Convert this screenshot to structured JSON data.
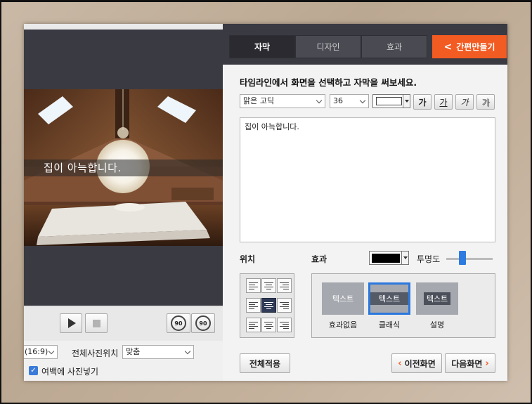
{
  "preview": {
    "subtitle": "집이 아늑합니다."
  },
  "player": {
    "rotate_left_label": "90",
    "rotate_right_label": "90"
  },
  "left_bottom": {
    "ratio_value": "(16:9)",
    "position_label": "전체사진위치",
    "position_value": "맞춤",
    "fill_margin_label": "여백에 사진넣기",
    "fill_margin_checked": true
  },
  "tabs": [
    {
      "label": "자막",
      "active": true
    },
    {
      "label": "디자인",
      "active": false
    },
    {
      "label": "효과",
      "active": false
    }
  ],
  "quick_make": {
    "label": "간편만들기"
  },
  "instruction": "타임라인에서 화면을 선택하고 자막을 써보세요.",
  "font": {
    "family": "맑은 고딕",
    "size": "36",
    "text_color": "#ffffff",
    "style_buttons": [
      "가",
      "가",
      "가",
      "가"
    ]
  },
  "caption_text": "집이 아늑합니다.",
  "position_section": {
    "label": "위치"
  },
  "effect_section": {
    "label": "효과",
    "bg_color": "#000000",
    "opacity_label": "투명도",
    "opacity_value": 0.35,
    "items": [
      {
        "card_text": "텍스트",
        "label": "효과없음"
      },
      {
        "card_text": "텍스트",
        "label": "클래식"
      },
      {
        "card_text": "텍스트",
        "label": "설명"
      }
    ]
  },
  "buttons": {
    "apply_all": "전체적용",
    "prev": "이전화면",
    "next": "다음화면"
  }
}
